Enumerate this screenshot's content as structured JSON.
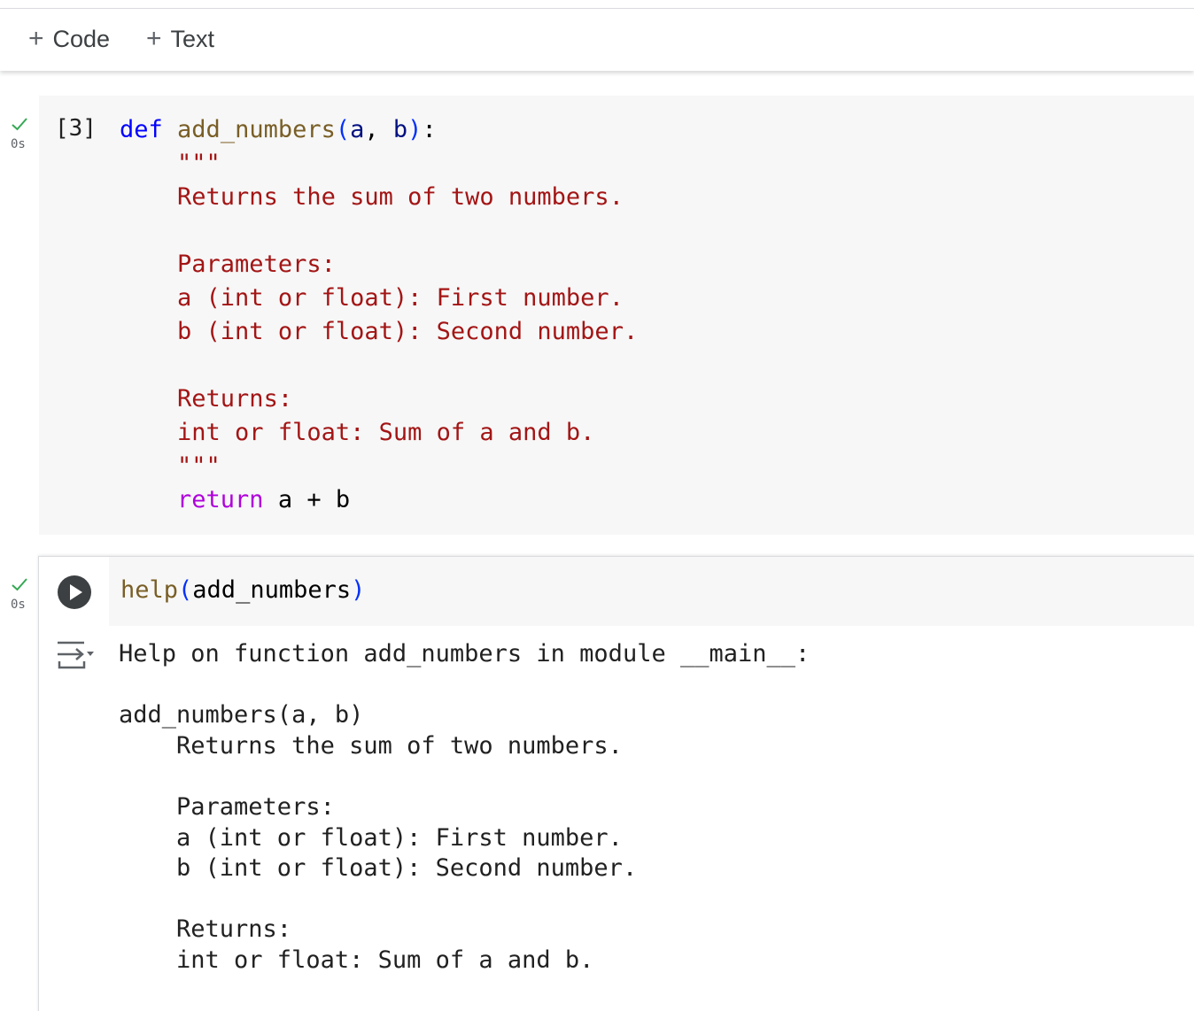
{
  "toolbar": {
    "add_code_label": "Code",
    "add_text_label": "Text"
  },
  "cells": [
    {
      "status": "0s",
      "exec_count": "[3]",
      "code": {
        "def_kw": "def",
        "func_name": "add_numbers",
        "open_paren": "(",
        "param_a": "a",
        "comma": ", ",
        "param_b": "b",
        "close_paren": ")",
        "colon": ":",
        "doc_open": "\"\"\"",
        "doc_line1": "Returns the sum of two numbers.",
        "doc_line2": "Parameters:",
        "doc_line3": "a (int or float): First number.",
        "doc_line4": "b (int or float): Second number.",
        "doc_line5": "Returns:",
        "doc_line6": "int or float: Sum of a and b.",
        "doc_close": "\"\"\"",
        "return_kw": "return",
        "return_expr": "a + b"
      }
    },
    {
      "status": "0s",
      "code": {
        "func": "help",
        "open_paren": "(",
        "arg": "add_numbers",
        "close_paren": ")"
      },
      "output": "Help on function add_numbers in module __main__:\n\nadd_numbers(a, b)\n    Returns the sum of two numbers.\n\n    Parameters:\n    a (int or float): First number.\n    b (int or float): Second number.\n\n    Returns:\n    int or float: Sum of a and b."
    }
  ],
  "colors": {
    "keyword": "#0000ff",
    "function": "#795e26",
    "parameter": "#001080",
    "bracket": "#0431fa",
    "string": "#a31515",
    "control_keyword": "#af00db",
    "success_check": "#34a853",
    "cell_background": "#f7f7f7"
  }
}
